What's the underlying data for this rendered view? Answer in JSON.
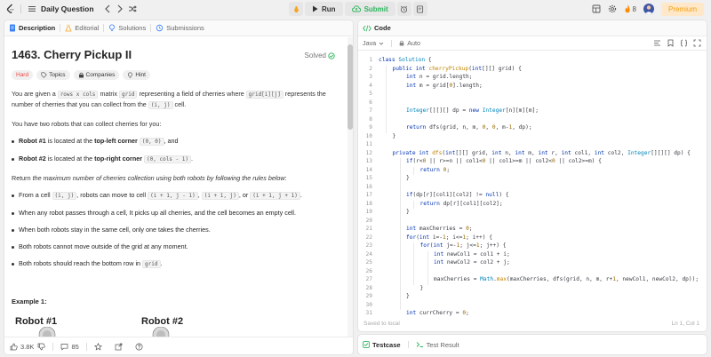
{
  "nav": {
    "title": "Daily Question",
    "run_label": "Run",
    "submit_label": "Submit",
    "streak_count": "8",
    "premium_label": "Premium"
  },
  "left_tabs": [
    "Description",
    "Editorial",
    "Solutions",
    "Submissions"
  ],
  "problem": {
    "title": "1463. Cherry Pickup II",
    "status": "Solved",
    "difficulty": "Hard",
    "tags": [
      "Topics",
      "Companies",
      "Hint"
    ],
    "p1_a": "You are given a",
    "p1_code1": "rows x cols",
    "p1_b": "matrix",
    "p1_code2": "grid",
    "p1_c": "representing a field of cherries where",
    "p1_code3": "grid[i][j]",
    "p1_d": "represents the",
    "p1_e": "number of cherries that you can collect from the",
    "p1_code4": "(i, j)",
    "p1_f": "cell.",
    "p2": "You have two robots that can collect cherries for you:",
    "b1_bold": "Robot #1",
    "b1_a": "is located at the",
    "b1_bold2": "top-left corner",
    "b1_code": "(0, 0)",
    "b1_b": ", and",
    "b2_bold": "Robot #2",
    "b2_a": "is located at the",
    "b2_bold2": "top-right corner",
    "b2_code": "(0, cols - 1)",
    "b2_b": ".",
    "p3_a": "Return",
    "p3_em": "the maximum number of cherries collection using both robots by following the rules below",
    "p3_b": ":",
    "r1_a": "From a cell",
    "r1_code1": "(i, j)",
    "r1_b": ", robots can move to cell",
    "r1_code2": "(i + 1, j - 1)",
    "r1_c": ",",
    "r1_code3": "(i + 1, j)",
    "r1_d": ", or",
    "r1_code4": "(i + 1, j + 1)",
    "r1_e": ".",
    "r2": "When any robot passes through a cell, It picks up all cherries, and the cell becomes an empty cell.",
    "r3": "When both robots stay in the same cell, only one takes the cherries.",
    "r4": "Both robots cannot move outside of the grid at any moment.",
    "r5_a": "Both robots should reach the bottom row in",
    "r5_code": "grid",
    "r5_b": ".",
    "example_head": "Example 1:",
    "robot1_label": "Robot #1",
    "robot2_label": "Robot #2"
  },
  "left_bottom": {
    "likes": "3.8K",
    "comments": "85"
  },
  "code_panel": {
    "tab": "Code",
    "language": "Java",
    "mode": "Auto",
    "saved": "Saved to local",
    "cursor": "Ln 1, Col 1"
  },
  "test_tabs": [
    "Testcase",
    "Test Result"
  ],
  "code_lines": [
    {
      "n": "1",
      "indent": 0,
      "segs": [
        [
          "kw",
          "class "
        ],
        [
          "ty",
          "Solution"
        ],
        [
          "ct",
          " {"
        ]
      ]
    },
    {
      "n": "2",
      "indent": 1,
      "segs": [
        [
          "kw",
          "public int "
        ],
        [
          "fn",
          "cherryPickup"
        ],
        [
          "ct",
          "("
        ],
        [
          "kw",
          "int"
        ],
        [
          "ct",
          "[][] grid) {"
        ]
      ]
    },
    {
      "n": "3",
      "indent": 2,
      "segs": [
        [
          "kw",
          "int "
        ],
        [
          "ct",
          "n = grid.length;"
        ]
      ]
    },
    {
      "n": "4",
      "indent": 2,
      "segs": [
        [
          "kw",
          "int "
        ],
        [
          "ct",
          "m = grid["
        ],
        [
          "nm",
          "0"
        ],
        [
          "ct",
          "].length;"
        ]
      ]
    },
    {
      "n": "5",
      "indent": 0,
      "segs": []
    },
    {
      "n": "6",
      "indent": 0,
      "segs": []
    },
    {
      "n": "7",
      "indent": 2,
      "segs": [
        [
          "ty",
          "Integer"
        ],
        [
          "ct",
          "[][][] dp = "
        ],
        [
          "kw",
          "new "
        ],
        [
          "ty",
          "Integer"
        ],
        [
          "ct",
          "[n][m][m];"
        ]
      ]
    },
    {
      "n": "8",
      "indent": 0,
      "segs": []
    },
    {
      "n": "9",
      "indent": 2,
      "segs": [
        [
          "kw",
          "return "
        ],
        [
          "ct",
          "dfs(grid, n, m, "
        ],
        [
          "nm",
          "0"
        ],
        [
          "ct",
          ", "
        ],
        [
          "nm",
          "0"
        ],
        [
          "ct",
          ", m-"
        ],
        [
          "nm",
          "1"
        ],
        [
          "ct",
          ", dp);"
        ]
      ]
    },
    {
      "n": "10",
      "indent": 1,
      "segs": [
        [
          "ct",
          "}"
        ]
      ]
    },
    {
      "n": "11",
      "indent": 0,
      "segs": []
    },
    {
      "n": "12",
      "indent": 1,
      "segs": [
        [
          "kw",
          "private int "
        ],
        [
          "fn",
          "dfs"
        ],
        [
          "ct",
          "("
        ],
        [
          "kw",
          "int"
        ],
        [
          "ct",
          "[][] grid, "
        ],
        [
          "kw",
          "int "
        ],
        [
          "ct",
          "n, "
        ],
        [
          "kw",
          "int "
        ],
        [
          "ct",
          "m, "
        ],
        [
          "kw",
          "int "
        ],
        [
          "ct",
          "r, "
        ],
        [
          "kw",
          "int "
        ],
        [
          "ct",
          "col1, "
        ],
        [
          "kw",
          "int "
        ],
        [
          "ct",
          "col2, "
        ],
        [
          "ty",
          "Integer"
        ],
        [
          "ct",
          "[][][] dp) {"
        ]
      ]
    },
    {
      "n": "13",
      "indent": 2,
      "segs": [
        [
          "kw",
          "if"
        ],
        [
          "ct",
          "(r<"
        ],
        [
          "nm",
          "0"
        ],
        [
          "ct",
          " || r>=n || col1<"
        ],
        [
          "nm",
          "0"
        ],
        [
          "ct",
          " || col1>=m || col2<"
        ],
        [
          "nm",
          "0"
        ],
        [
          "ct",
          " || col2>=m) {"
        ]
      ]
    },
    {
      "n": "14",
      "indent": 3,
      "segs": [
        [
          "kw",
          "return "
        ],
        [
          "nm",
          "0"
        ],
        [
          "ct",
          ";"
        ]
      ]
    },
    {
      "n": "15",
      "indent": 2,
      "segs": [
        [
          "ct",
          "}"
        ]
      ]
    },
    {
      "n": "16",
      "indent": 0,
      "segs": []
    },
    {
      "n": "17",
      "indent": 2,
      "segs": [
        [
          "kw",
          "if"
        ],
        [
          "ct",
          "(dp[r][col1][col2] != "
        ],
        [
          "kw",
          "null"
        ],
        [
          "ct",
          ") {"
        ]
      ]
    },
    {
      "n": "18",
      "indent": 3,
      "segs": [
        [
          "kw",
          "return "
        ],
        [
          "ct",
          "dp[r][col1][col2];"
        ]
      ]
    },
    {
      "n": "19",
      "indent": 2,
      "segs": [
        [
          "ct",
          "}"
        ]
      ]
    },
    {
      "n": "20",
      "indent": 0,
      "segs": []
    },
    {
      "n": "21",
      "indent": 2,
      "segs": [
        [
          "kw",
          "int "
        ],
        [
          "ct",
          "maxCherries = "
        ],
        [
          "nm",
          "0"
        ],
        [
          "ct",
          ";"
        ]
      ]
    },
    {
      "n": "22",
      "indent": 2,
      "segs": [
        [
          "kw",
          "for"
        ],
        [
          "ct",
          "("
        ],
        [
          "kw",
          "int "
        ],
        [
          "ct",
          "i=-"
        ],
        [
          "nm",
          "1"
        ],
        [
          "ct",
          "; i<="
        ],
        [
          "nm",
          "1"
        ],
        [
          "ct",
          "; i++) {"
        ]
      ]
    },
    {
      "n": "23",
      "indent": 3,
      "segs": [
        [
          "kw",
          "for"
        ],
        [
          "ct",
          "("
        ],
        [
          "kw",
          "int "
        ],
        [
          "ct",
          "j=-"
        ],
        [
          "nm",
          "1"
        ],
        [
          "ct",
          "; j<="
        ],
        [
          "nm",
          "1"
        ],
        [
          "ct",
          "; j++) {"
        ]
      ]
    },
    {
      "n": "24",
      "indent": 4,
      "segs": [
        [
          "kw",
          "int "
        ],
        [
          "ct",
          "newCol1 = col1 + i;"
        ]
      ]
    },
    {
      "n": "25",
      "indent": 4,
      "segs": [
        [
          "kw",
          "int "
        ],
        [
          "ct",
          "newCol2 = col2 + j;"
        ]
      ]
    },
    {
      "n": "26",
      "indent": 0,
      "segs": []
    },
    {
      "n": "27",
      "indent": 4,
      "segs": [
        [
          "ct",
          "maxCherries = "
        ],
        [
          "ty",
          "Math"
        ],
        [
          "ct",
          "."
        ],
        [
          "fn",
          "max"
        ],
        [
          "ct",
          "(maxCherries, dfs(grid, n, m, r+"
        ],
        [
          "nm",
          "1"
        ],
        [
          "ct",
          ", newCol1, newCol2, dp));"
        ]
      ]
    },
    {
      "n": "28",
      "indent": 3,
      "segs": [
        [
          "ct",
          "}"
        ]
      ]
    },
    {
      "n": "29",
      "indent": 2,
      "segs": [
        [
          "ct",
          "}"
        ]
      ]
    },
    {
      "n": "30",
      "indent": 0,
      "segs": []
    },
    {
      "n": "31",
      "indent": 2,
      "segs": [
        [
          "kw",
          "int "
        ],
        [
          "ct",
          "currCherry = "
        ],
        [
          "nm",
          "0"
        ],
        [
          "ct",
          ";"
        ]
      ]
    }
  ]
}
